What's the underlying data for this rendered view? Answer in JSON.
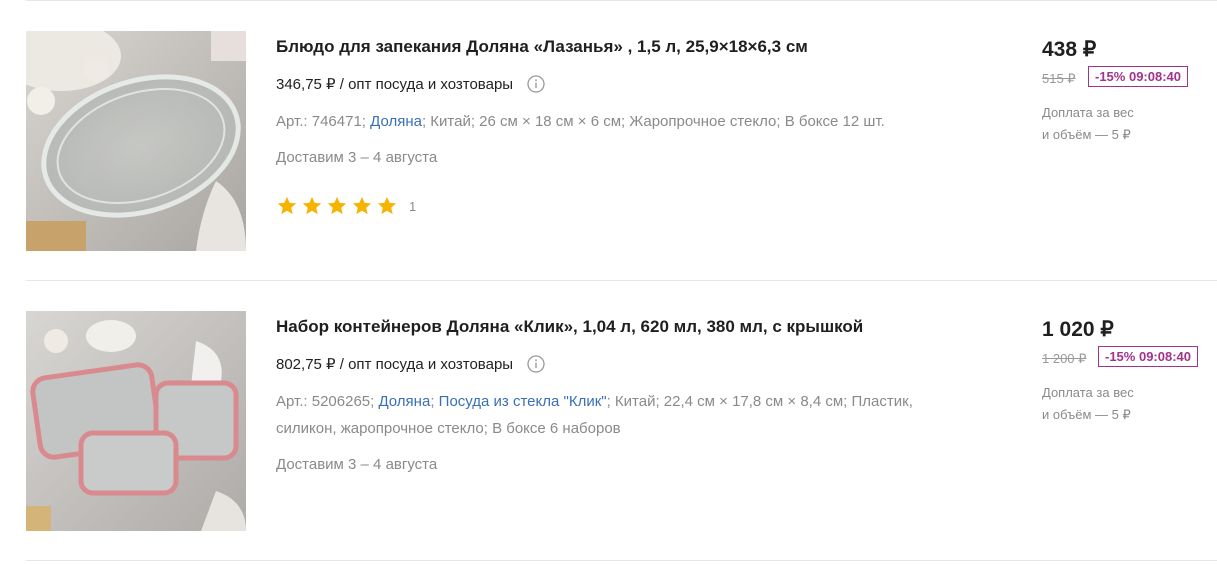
{
  "colors": {
    "accent_link": "#3a70b8",
    "discount": "#a0338b",
    "star": "#f5b400"
  },
  "products": [
    {
      "image": "glass-baking-dish-photo",
      "title": "Блюдо для запекания Доляна «Лазанья» , 1,5 л, 25,9×18×6,3 см",
      "opt_price": "346,75 ₽ / опт посуда и хозтовары",
      "spec_art": "Арт.: 746471;",
      "spec_brand": "Доляна",
      "spec_rest": "; Китай; 26 см × 18 см × 6 см; Жаропрочное стекло; В боксе 12 шт.",
      "delivery": "Доставим 3 – 4 августа",
      "rating_stars": 5,
      "rating_count": "1",
      "price": "438 ₽",
      "old_price": "515 ₽",
      "discount": "-15% 09:08:40",
      "extra_line1": "Доплата за вес",
      "extra_line2": "и объём — 5 ₽"
    },
    {
      "image": "glass-containers-set-photo",
      "title": "Набор контейнеров Доляна «Клик», 1,04 л, 620 мл, 380 мл, с крышкой",
      "opt_price": "802,75 ₽ / опт посуда и хозтовары",
      "spec_art": "Арт.: 5206265;",
      "spec_brand": "Доляна",
      "spec_sep": ";",
      "spec_series": "Посуда из стекла \"Клик\"",
      "spec_rest": "; Китай; 22,4 см × 17,8 см × 8,4 см; Пластик, силикон, жаропрочное стекло; В боксе 6 наборов",
      "delivery": "Доставим 3 – 4 августа",
      "price": "1 020 ₽",
      "old_price": "1 200 ₽",
      "discount": "-15% 09:08:40",
      "extra_line1": "Доплата за вес",
      "extra_line2": "и объём — 5 ₽"
    }
  ]
}
